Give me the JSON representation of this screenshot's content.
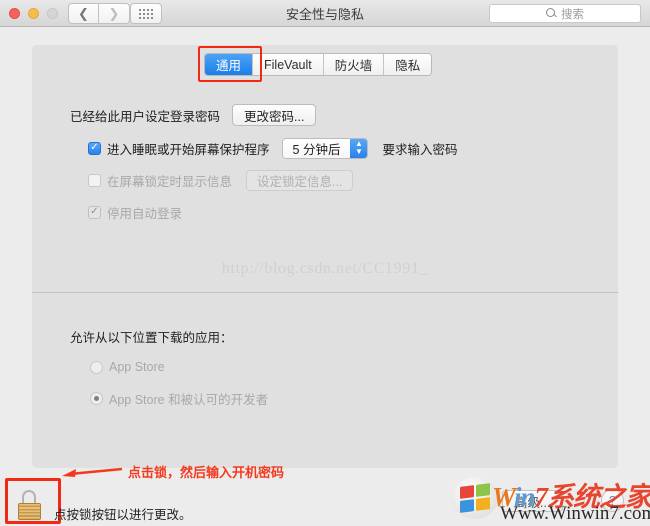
{
  "window": {
    "title": "安全性与隐私",
    "traffic_lights": [
      "close",
      "minimize",
      "zoom"
    ],
    "nav_back_icon": "chevron-left-icon",
    "nav_forward_icon": "chevron-right-icon",
    "grid_icon": "grid-dots-icon"
  },
  "search": {
    "icon": "search-icon",
    "placeholder": "搜索",
    "value": ""
  },
  "tabs": [
    {
      "label": "通用",
      "active": true
    },
    {
      "label": "FileVault",
      "active": false
    },
    {
      "label": "防火墙",
      "active": false
    },
    {
      "label": "隐私",
      "active": false
    }
  ],
  "password_section": {
    "status_label": "已经给此用户设定登录密码",
    "change_password_button": "更改密码...",
    "options": [
      {
        "label": "进入睡眠或开始屏幕保护程序",
        "checked": true,
        "enabled": true,
        "popup_value": "5 分钟后",
        "trailing_label": "要求输入密码"
      },
      {
        "label": "在屏幕锁定时显示信息",
        "checked": false,
        "enabled": false,
        "button_label": "设定锁定信息..."
      },
      {
        "label": "停用自动登录",
        "checked": true,
        "enabled": false
      }
    ]
  },
  "download_section": {
    "title": "允许从以下位置下载的应用：",
    "options": [
      {
        "label": "App Store",
        "selected": false
      },
      {
        "label": "App Store 和被认可的开发者",
        "selected": true
      }
    ]
  },
  "bottom_bar": {
    "lock_icon": "padlock-closed-icon",
    "lock_text": "点按锁按钮以进行更改。",
    "advanced_button": "高级...",
    "help_button": "?"
  },
  "annotations": {
    "arrow_icon": "arrow-left-icon",
    "lock_hint": "点击锁，然后输入开机密码",
    "color": "#f4391f",
    "box_color": "#f22a14"
  },
  "watermarks": {
    "url": "http://blog.csdn.net/CC1991_",
    "logo_w": "W",
    "logo_in": "in",
    "logo_7": "7",
    "logo_cn": "系统之家",
    "logo_sub": "Www.Winwin7.com"
  }
}
